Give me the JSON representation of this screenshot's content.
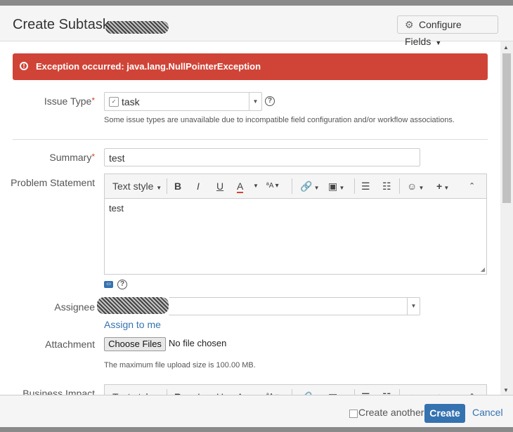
{
  "header": {
    "title": "Create Subtask",
    "configure_label": "Configure Fields"
  },
  "error": {
    "message": "Exception occurred: java.lang.NullPointerException"
  },
  "issue_type": {
    "label": "Issue Type",
    "value": "task",
    "note": "Some issue types are unavailable due to incompatible field configuration and/or workflow associations."
  },
  "summary": {
    "label": "Summary",
    "value": "test"
  },
  "problem_statement": {
    "label": "Problem Statement",
    "text_style": "Text style",
    "content": "test"
  },
  "assignee": {
    "label": "Assignee",
    "assign_to_me": "Assign to me"
  },
  "attachment": {
    "label": "Attachment",
    "button": "Choose Files",
    "status": "No file chosen",
    "note": "The maximum file upload size is 100.00 MB."
  },
  "business_impact": {
    "label": "Business Impact",
    "text_style": "Text style"
  },
  "toolbar": {
    "bold": "B",
    "italic": "I",
    "underline": "U",
    "color": "A",
    "format": "ªA"
  },
  "footer": {
    "create_another": "Create another",
    "create": "Create",
    "cancel": "Cancel"
  },
  "colors": {
    "error_bg": "#d04437",
    "primary": "#3572b0"
  }
}
